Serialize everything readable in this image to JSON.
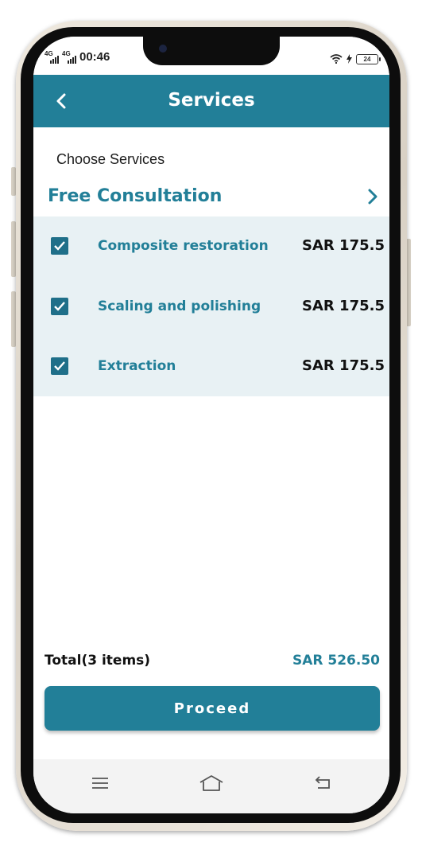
{
  "status_bar": {
    "network_1": "4G",
    "network_2": "4G",
    "time": "00:46",
    "battery": "24",
    "icons": [
      "signal-icon",
      "signal-icon",
      "wifi-icon",
      "charging-icon",
      "battery-icon"
    ]
  },
  "header": {
    "title": "Services",
    "back_icon": "chevron-left-icon"
  },
  "section_label": "Choose Services",
  "consultation": {
    "label": "Free Consultation",
    "icon": "chevron-right-icon"
  },
  "services": [
    {
      "name": "Composite restoration",
      "price": "SAR 175.5",
      "checked": true
    },
    {
      "name": "Scaling and polishing",
      "price": "SAR 175.5",
      "checked": true
    },
    {
      "name": "Extraction",
      "price": "SAR 175.5",
      "checked": true
    }
  ],
  "footer": {
    "total_label": "Total(3 items)",
    "total_value": "SAR 526.50",
    "proceed_label": "Proceed"
  },
  "nav_bar": {
    "icons": [
      "menu-icon",
      "home-icon",
      "back-icon"
    ]
  },
  "colors": {
    "primary": "#227f98",
    "panel_bg": "#e8f1f4",
    "checkbox": "#1f6f89"
  }
}
